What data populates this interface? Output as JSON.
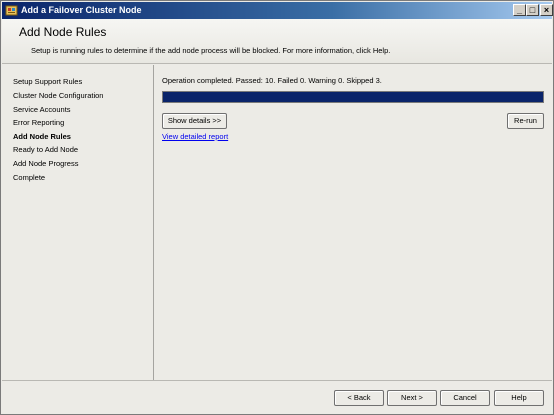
{
  "window": {
    "title": "Add a Failover Cluster Node",
    "minimize_glyph": "_",
    "maximize_glyph": "□",
    "close_glyph": "×"
  },
  "header": {
    "title": "Add Node Rules",
    "description": "Setup is running rules to determine if the add node process will be blocked. For more information, click Help."
  },
  "sidebar": {
    "steps": [
      {
        "label": "Setup Support Rules",
        "active": false
      },
      {
        "label": "Cluster Node Configuration",
        "active": false
      },
      {
        "label": "Service Accounts",
        "active": false
      },
      {
        "label": "Error Reporting",
        "active": false
      },
      {
        "label": "Add Node Rules",
        "active": true
      },
      {
        "label": "Ready to Add Node",
        "active": false
      },
      {
        "label": "Add Node Progress",
        "active": false
      },
      {
        "label": "Complete",
        "active": false
      }
    ]
  },
  "main": {
    "status_text": "Operation completed. Passed: 10.   Failed 0.   Warning 0.   Skipped 3.",
    "progress_fraction": 1.0,
    "show_details_label": "Show details >>",
    "rerun_label": "Re-run",
    "report_link": "View detailed report"
  },
  "footer": {
    "back_label": "< Back",
    "next_label": "Next >",
    "cancel_label": "Cancel",
    "help_label": "Help"
  },
  "colors": {
    "progress_fill": "#0a246a",
    "link": "#0000ee"
  }
}
